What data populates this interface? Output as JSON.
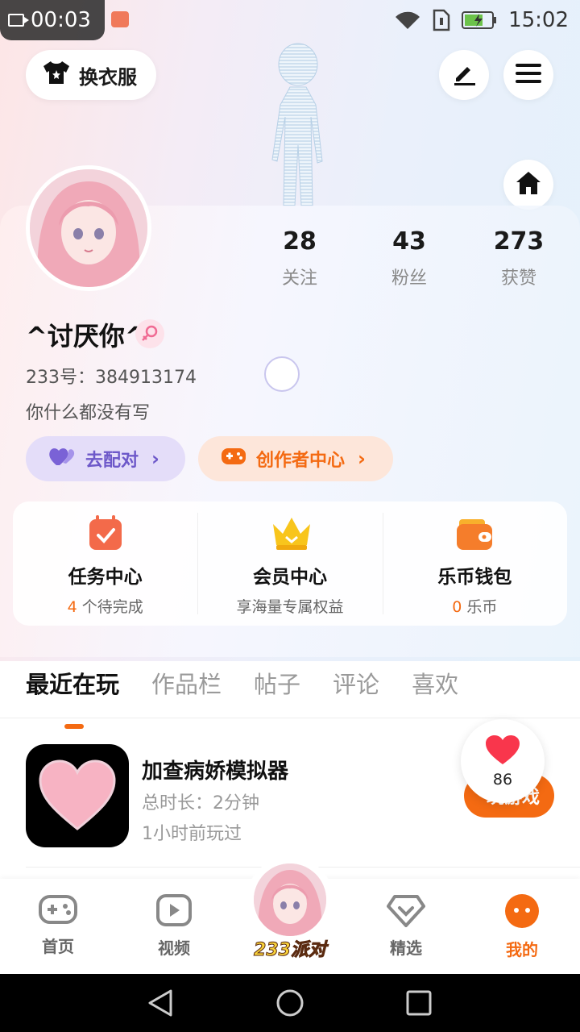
{
  "status_bar": {
    "record_time": "00:03",
    "clock": "15:02",
    "icons": [
      "wifi-icon",
      "sim-icon",
      "battery-icon"
    ]
  },
  "header": {
    "outfit_label": "换衣服",
    "icons": [
      "tshirt-icon",
      "edit-icon",
      "menu-icon",
      "home-icon"
    ]
  },
  "profile": {
    "stats": [
      {
        "value": "28",
        "label": "关注"
      },
      {
        "value": "43",
        "label": "粉丝"
      },
      {
        "value": "273",
        "label": "获赞"
      }
    ],
    "username": "^讨厌你^",
    "gender": "female",
    "uid": "233号：384913174",
    "bio": "你什么都没有写"
  },
  "actions": {
    "match_label": "去配对",
    "creator_label": "创作者中心"
  },
  "services": [
    {
      "title": "任务中心",
      "sub_prefix": "4",
      "sub_suffix": " 个待完成",
      "icon": "task-calendar-icon"
    },
    {
      "title": "会员中心",
      "sub": "享海量专属权益",
      "icon": "crown-icon"
    },
    {
      "title": "乐币钱包",
      "sub_prefix": "0",
      "sub_suffix": " 乐币",
      "icon": "wallet-icon"
    }
  ],
  "tabs": [
    {
      "label": "最近在玩",
      "active": true
    },
    {
      "label": "作品栏",
      "active": false
    },
    {
      "label": "帖子",
      "active": false
    },
    {
      "label": "评论",
      "active": false
    },
    {
      "label": "喜欢",
      "active": false
    }
  ],
  "recent_games": [
    {
      "name": "加查病娇模拟器",
      "duration": "总时长：2分钟",
      "last_played": "1小时前玩过",
      "play_label": "玩游戏"
    }
  ],
  "like_float": {
    "count": "86"
  },
  "bottom_nav": [
    {
      "label": "首页",
      "icon": "gamepad-icon",
      "active": false
    },
    {
      "label": "视频",
      "icon": "video-play-icon",
      "active": false
    },
    {
      "label": "233派对",
      "icon": "party-avatar-icon",
      "active": false
    },
    {
      "label": "精选",
      "icon": "heart-gem-icon",
      "active": false
    },
    {
      "label": "我的",
      "icon": "profile-face-icon",
      "active": true
    }
  ],
  "colors": {
    "accent": "#f46a12",
    "match_purple": "#6d58c9",
    "match_bg": "#e4ddf9",
    "creator_bg": "#fde6da"
  }
}
